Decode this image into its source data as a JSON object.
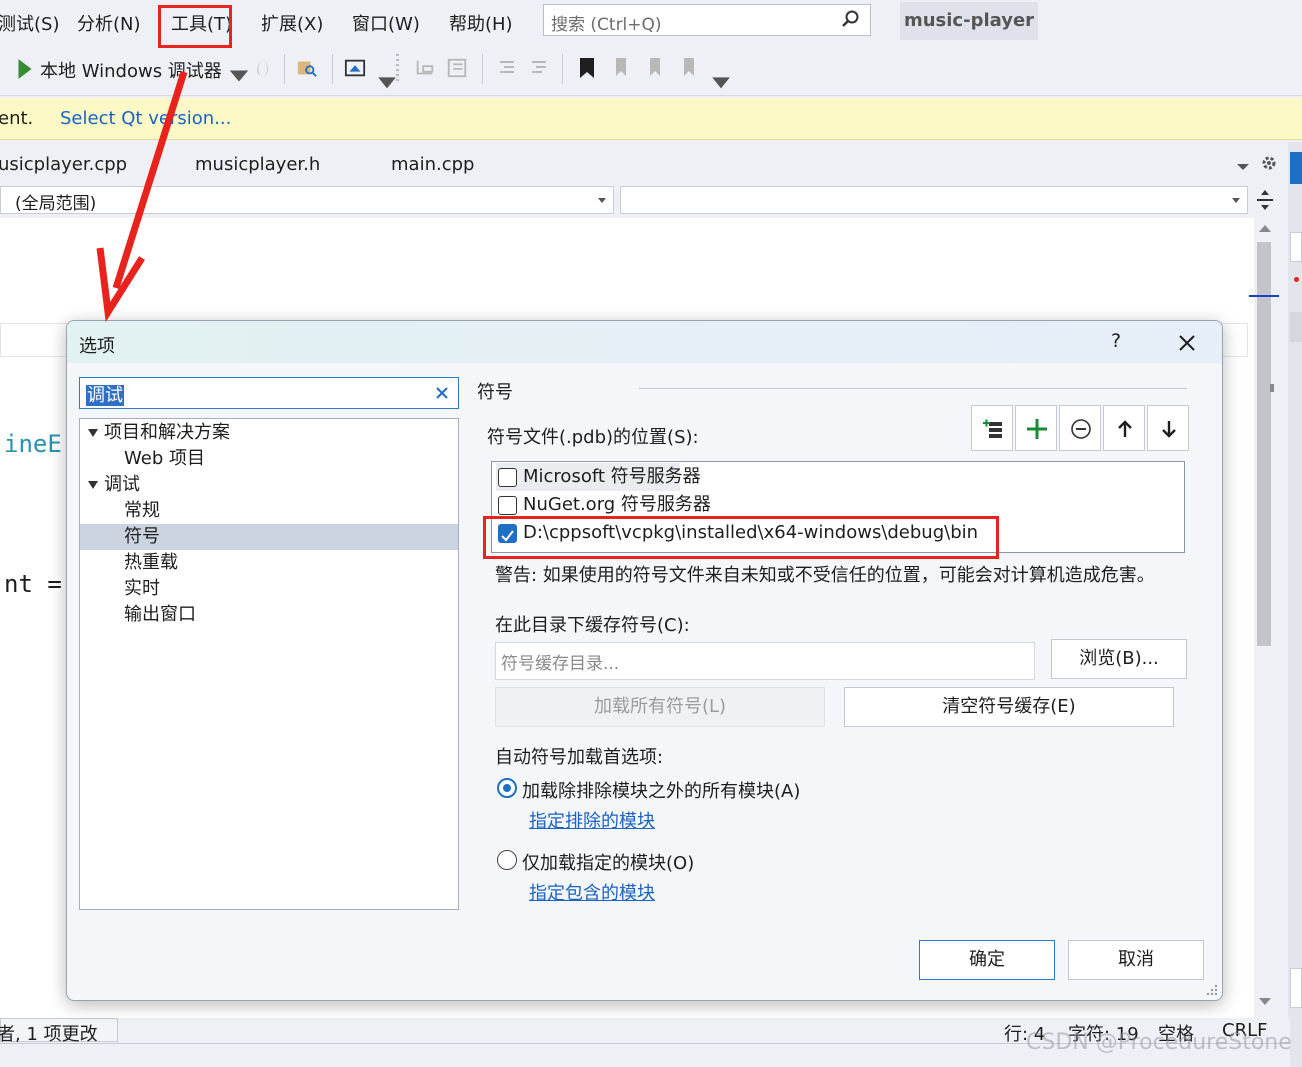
{
  "menu": {
    "items": [
      "测试(S)",
      "分析(N)",
      "工具(T)",
      "扩展(X)",
      "窗口(W)",
      "帮助(H)"
    ],
    "search_placeholder": "搜索 (Ctrl+Q)",
    "project_name": "music-player"
  },
  "toolbar": {
    "debugger_label": "本地 Windows 调试器"
  },
  "infobar": {
    "message": "ent.",
    "link": "Select Qt version..."
  },
  "tabs": [
    "usicplayer.cpp",
    "musicplayer.h",
    "main.cpp"
  ],
  "navbar": {
    "scope": "(全局范围)",
    "member": ""
  },
  "editor": {
    "code_lines": [
      "ineE",
      "nt ="
    ]
  },
  "statusbar": {
    "changes": "者, 1 项更改",
    "line": "行: 4",
    "char": "字符: 19",
    "spacing": "空格",
    "eol": "CRLF"
  },
  "dialog": {
    "title": "选项",
    "help": "?",
    "filter_value": "调试",
    "tree": [
      {
        "label": "项目和解决方案",
        "level": 0,
        "expanded": true
      },
      {
        "label": "Web 项目",
        "level": 1
      },
      {
        "label": "调试",
        "level": 0,
        "expanded": true
      },
      {
        "label": "常规",
        "level": 1
      },
      {
        "label": "符号",
        "level": 1,
        "selected": true
      },
      {
        "label": "热重载",
        "level": 1
      },
      {
        "label": "实时",
        "level": 1
      },
      {
        "label": "输出窗口",
        "level": 1
      }
    ],
    "pane_title": "符号",
    "locations_label": "符号文件(.pdb)的位置(S):",
    "toolbar_icons": [
      "add-server-icon",
      "add-icon",
      "remove-icon",
      "move-up-icon",
      "move-down-icon"
    ],
    "symbol_locations": [
      {
        "label": "Microsoft 符号服务器",
        "checked": false
      },
      {
        "label": "NuGet.org 符号服务器",
        "checked": false
      },
      {
        "label": "D:\\cppsoft\\vcpkg\\installed\\x64-windows\\debug\\bin",
        "checked": true
      }
    ],
    "warning": "警告: 如果使用的符号文件来自未知或不受信任的位置，可能会对计算机造成危害。",
    "cache_label": "在此目录下缓存符号(C):",
    "cache_placeholder": "符号缓存目录...",
    "browse_button": "浏览(B)...",
    "load_all_button": "加载所有符号(L)",
    "clear_cache_button": "清空符号缓存(E)",
    "autoload_label": "自动符号加载首选项:",
    "radio_all": "加载除排除模块之外的所有模块(A)",
    "link_excluded": "指定排除的模块",
    "radio_specified": "仅加载指定的模块(O)",
    "link_included": "指定包含的模块",
    "ok_button": "确定",
    "cancel_button": "取消"
  },
  "watermark": "CSDN @ProcedureStone",
  "colors": {
    "accent": "#1f6fc5",
    "annotation_red": "#e8231d",
    "infobar_bg": "#fcf9c7"
  }
}
